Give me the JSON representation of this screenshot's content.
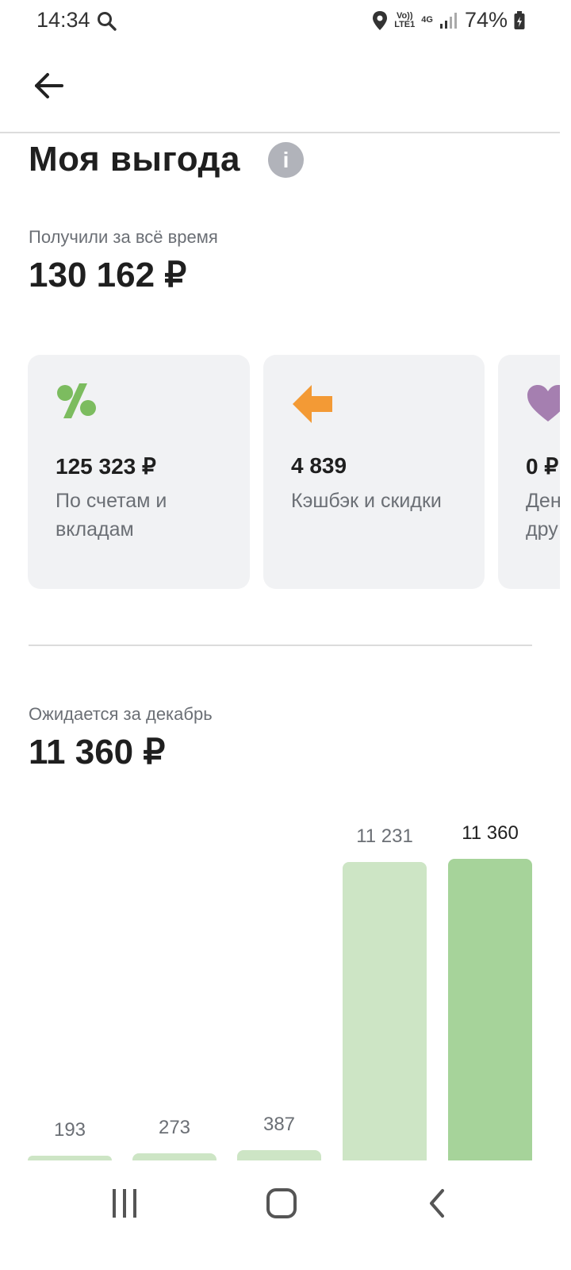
{
  "status_bar": {
    "time": "14:34",
    "network_top": "Vo))",
    "network_bottom": "LTE1",
    "network_type": "4G",
    "battery": "74%"
  },
  "page": {
    "title": "Моя выгода"
  },
  "total": {
    "label": "Получили за всё время",
    "amount": "130 162 ₽"
  },
  "cards": [
    {
      "icon": "percent-icon",
      "value": "125 323 ₽",
      "desc_line1": "По счетам и",
      "desc_line2": "вкладам",
      "color": "#7cbc5f"
    },
    {
      "icon": "arrow-left-icon",
      "value": "4 839",
      "desc_line1": "Кэшбэк и скидки",
      "desc_line2": "",
      "color": "#f39a35"
    },
    {
      "icon": "heart-icon",
      "value": "0 ₽",
      "desc_line1": "Ден",
      "desc_line2": "дру",
      "color": "#a57fb0"
    }
  ],
  "expected": {
    "label": "Ожидается за декабрь",
    "amount": "11 360 ₽"
  },
  "chart_data": {
    "type": "bar",
    "categories": [
      "",
      "",
      "",
      "",
      ""
    ],
    "values": [
      193,
      273,
      387,
      11231,
      11360
    ],
    "value_labels": [
      "193",
      "273",
      "387",
      "11 231",
      "11 360"
    ],
    "colors": [
      "#cde5c5",
      "#cde5c5",
      "#cde5c5",
      "#cde5c5",
      "#a6d39a"
    ],
    "ylim": [
      0,
      11360
    ]
  }
}
